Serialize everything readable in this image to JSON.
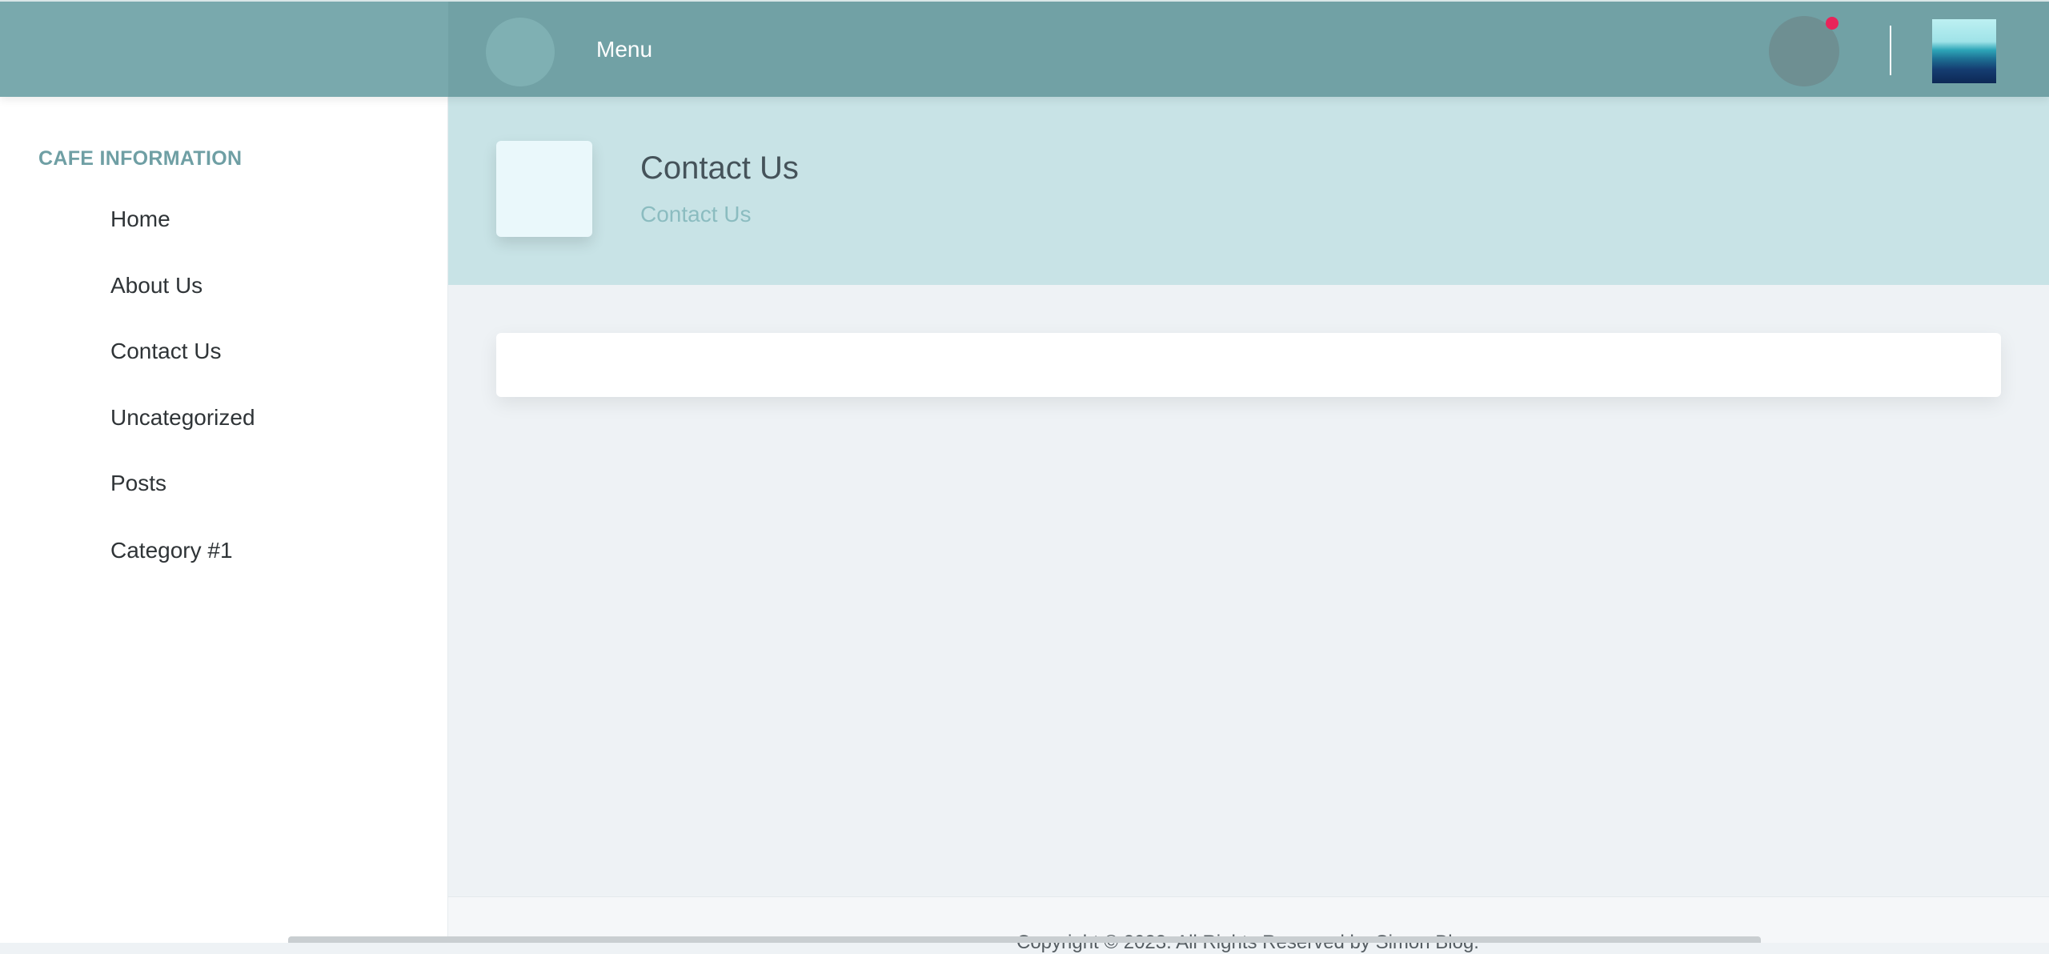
{
  "topbar": {
    "menu_label": "Menu",
    "notification_dot_color": "#e8245a",
    "accent_color": "#71a1a5"
  },
  "sidebar": {
    "heading": "CAFE INFORMATION",
    "items": [
      {
        "label": "Home"
      },
      {
        "label": "About Us"
      },
      {
        "label": "Contact Us"
      },
      {
        "label": "Uncategorized"
      },
      {
        "label": "Posts"
      },
      {
        "label": "Category #1"
      }
    ]
  },
  "page_header": {
    "title": "Contact Us",
    "breadcrumb": "Contact Us"
  },
  "footer": {
    "copyright": "Copyright © 2023. All Rights Reserved by Simon Blog."
  }
}
